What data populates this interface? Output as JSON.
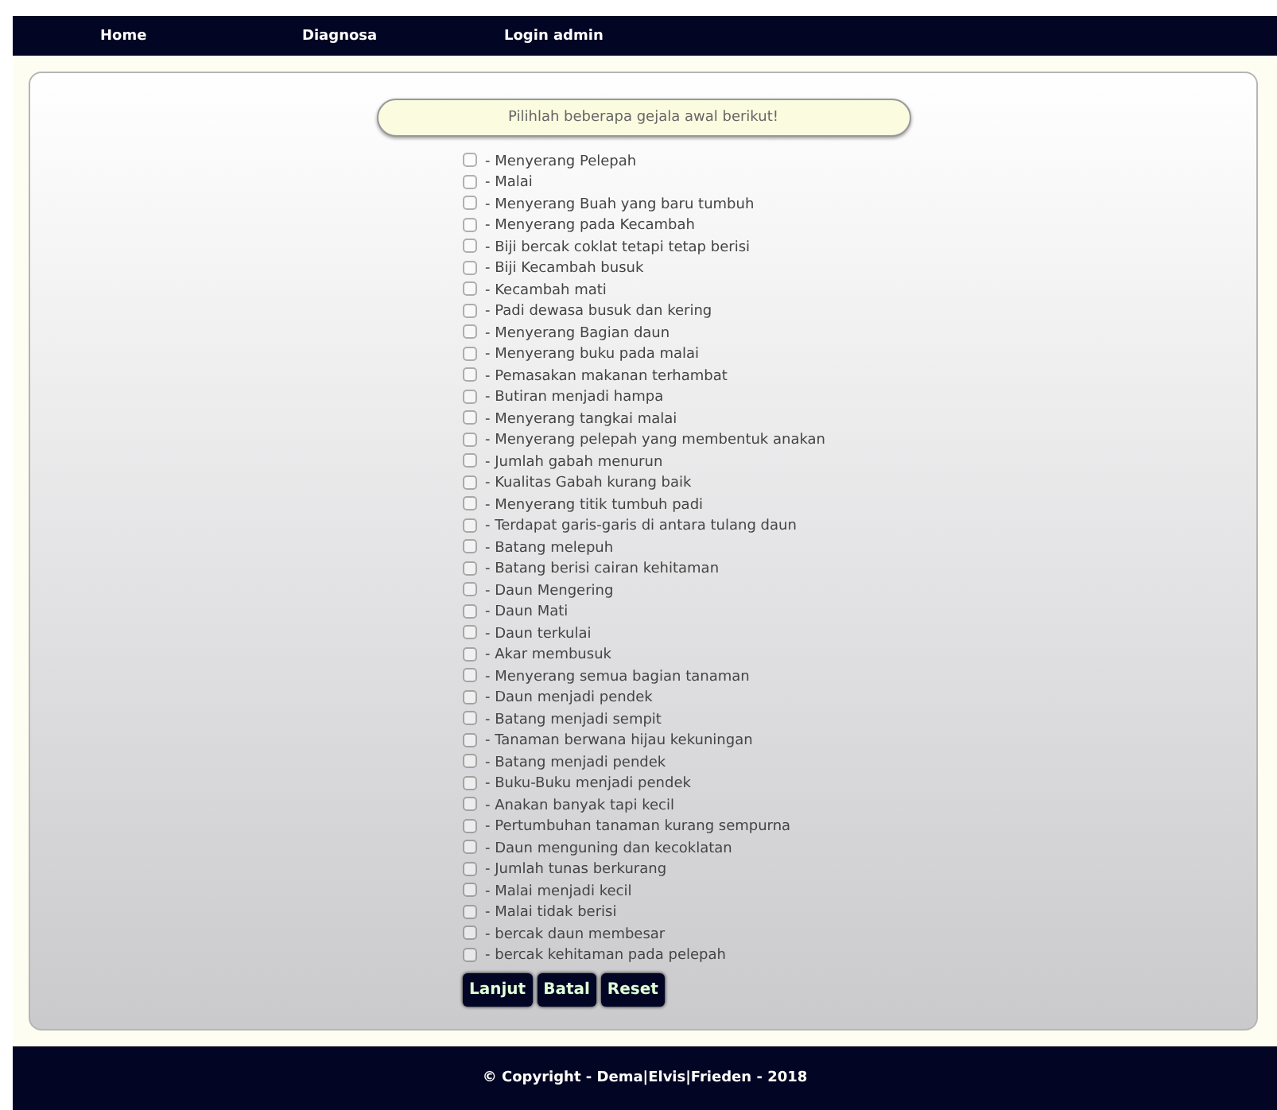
{
  "nav": [
    {
      "label": "Home"
    },
    {
      "label": "Diagnosa"
    },
    {
      "label": "Login admin"
    }
  ],
  "banner": "Pilihlah beberapa gejala awal berikut!",
  "symptoms": [
    {
      "label": "- Menyerang Pelepah",
      "checked": false
    },
    {
      "label": "- Malai",
      "checked": false
    },
    {
      "label": "- Menyerang Buah yang baru tumbuh",
      "checked": false
    },
    {
      "label": "- Menyerang pada Kecambah",
      "checked": false
    },
    {
      "label": "- Biji bercak coklat tetapi tetap berisi",
      "checked": false
    },
    {
      "label": "- Biji Kecambah busuk",
      "checked": false
    },
    {
      "label": "- Kecambah mati",
      "checked": false
    },
    {
      "label": "- Padi dewasa busuk dan kering",
      "checked": false
    },
    {
      "label": "- Menyerang Bagian daun",
      "checked": false
    },
    {
      "label": "- Menyerang buku pada malai",
      "checked": false
    },
    {
      "label": "- Pemasakan makanan terhambat",
      "checked": false
    },
    {
      "label": "- Butiran menjadi hampa",
      "checked": false
    },
    {
      "label": "- Menyerang tangkai malai",
      "checked": false
    },
    {
      "label": "- Menyerang pelepah yang membentuk anakan",
      "checked": false
    },
    {
      "label": "- Jumlah gabah menurun",
      "checked": false
    },
    {
      "label": "- Kualitas Gabah kurang baik",
      "checked": false
    },
    {
      "label": "- Menyerang titik tumbuh padi",
      "checked": false
    },
    {
      "label": "- Terdapat garis-garis di antara tulang daun",
      "checked": false
    },
    {
      "label": "- Batang melepuh",
      "checked": false
    },
    {
      "label": "- Batang berisi cairan kehitaman",
      "checked": false
    },
    {
      "label": "- Daun Mengering",
      "checked": false
    },
    {
      "label": "- Daun Mati",
      "checked": false
    },
    {
      "label": "- Daun terkulai",
      "checked": false
    },
    {
      "label": "- Akar membusuk",
      "checked": false
    },
    {
      "label": "- Menyerang semua bagian tanaman",
      "checked": false
    },
    {
      "label": "- Daun menjadi pendek",
      "checked": false
    },
    {
      "label": "- Batang menjadi sempit",
      "checked": false
    },
    {
      "label": "- Tanaman berwana hijau kekuningan",
      "checked": false
    },
    {
      "label": "- Batang menjadi pendek",
      "checked": false
    },
    {
      "label": "- Buku-Buku menjadi pendek",
      "checked": false
    },
    {
      "label": "- Anakan banyak tapi kecil",
      "checked": false
    },
    {
      "label": "- Pertumbuhan tanaman kurang sempurna",
      "checked": false
    },
    {
      "label": "- Daun menguning dan kecoklatan",
      "checked": false
    },
    {
      "label": "- Jumlah tunas berkurang",
      "checked": false
    },
    {
      "label": "- Malai menjadi kecil",
      "checked": false
    },
    {
      "label": "- Malai tidak berisi",
      "checked": false
    },
    {
      "label": "- bercak daun membesar",
      "checked": false
    },
    {
      "label": "- bercak kehitaman pada pelepah",
      "checked": false
    }
  ],
  "buttons": [
    {
      "label": "Lanjut"
    },
    {
      "label": "Batal"
    },
    {
      "label": "Reset"
    }
  ],
  "footer": "© Copyright - Dema|Elvis|Frieden - 2018"
}
